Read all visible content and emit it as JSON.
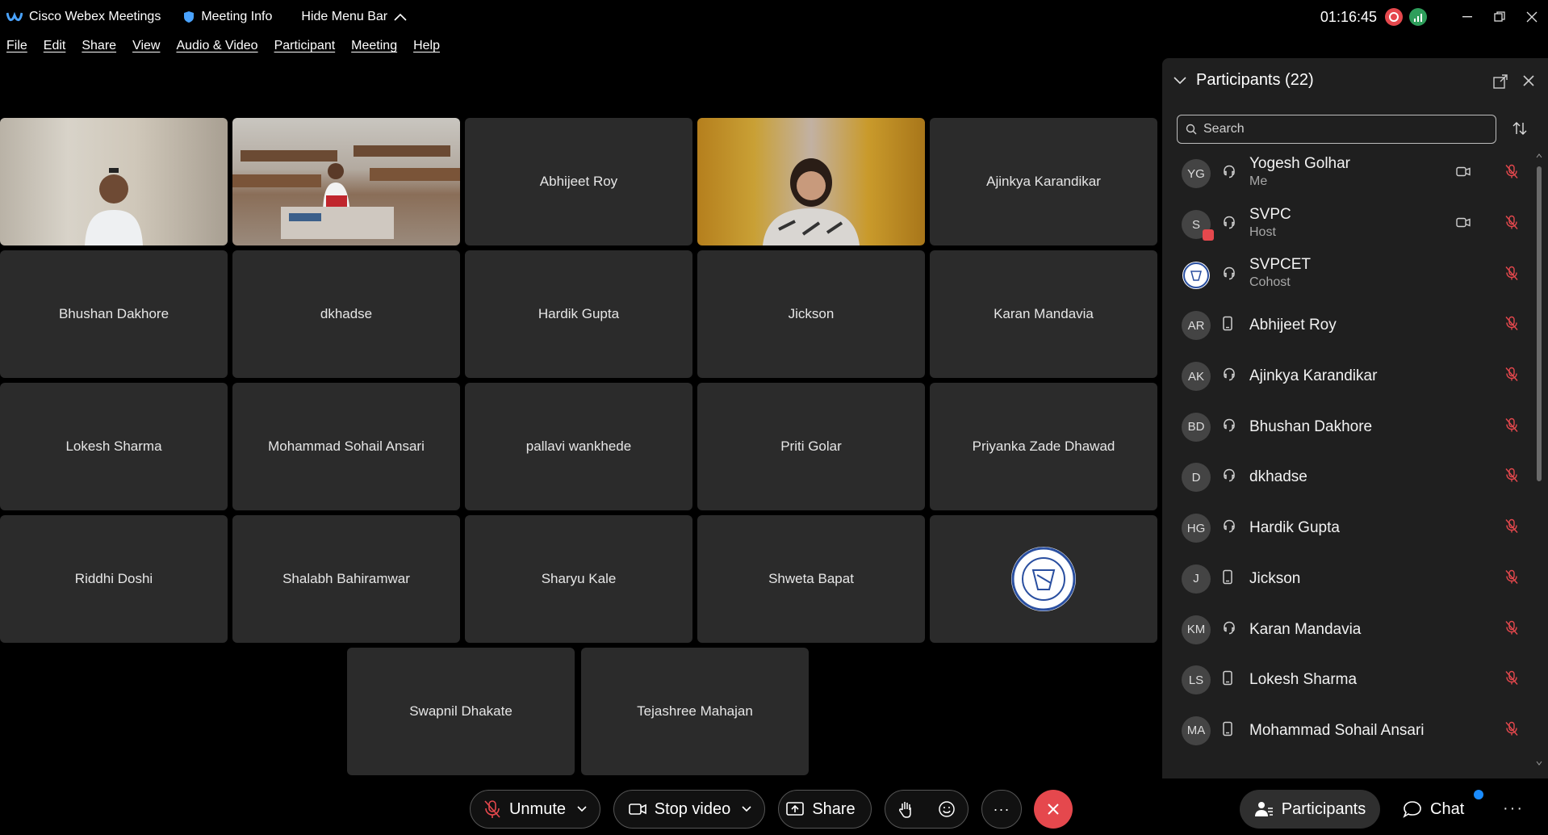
{
  "titlebar": {
    "app_name": "Cisco Webex Meetings",
    "meeting_info": "Meeting Info",
    "hide_menu_bar": "Hide Menu Bar",
    "timer": "01:16:45"
  },
  "menu": [
    "File",
    "Edit",
    "Share",
    "View",
    "Audio & Video",
    "Participant",
    "Meeting",
    "Help"
  ],
  "tiles": [
    {
      "name": "",
      "kind": "video1"
    },
    {
      "name": "",
      "kind": "video2"
    },
    {
      "name": "Abhijeet Roy",
      "kind": "name"
    },
    {
      "name": "",
      "kind": "video3"
    },
    {
      "name": "Ajinkya Karandikar",
      "kind": "name"
    },
    {
      "name": "Bhushan Dakhore",
      "kind": "name"
    },
    {
      "name": "dkhadse",
      "kind": "name"
    },
    {
      "name": "Hardik Gupta",
      "kind": "name"
    },
    {
      "name": "Jickson",
      "kind": "name"
    },
    {
      "name": "Karan Mandavia",
      "kind": "name"
    },
    {
      "name": "Lokesh Sharma",
      "kind": "name"
    },
    {
      "name": "Mohammad Sohail Ansari",
      "kind": "name"
    },
    {
      "name": "pallavi wankhede",
      "kind": "name"
    },
    {
      "name": "Priti Golar",
      "kind": "name"
    },
    {
      "name": "Priyanka Zade Dhawad",
      "kind": "name"
    },
    {
      "name": "Riddhi Doshi",
      "kind": "name"
    },
    {
      "name": "Shalabh Bahiramwar",
      "kind": "name"
    },
    {
      "name": "Sharyu Kale",
      "kind": "name"
    },
    {
      "name": "Shweta Bapat",
      "kind": "name"
    },
    {
      "name": "",
      "kind": "logo"
    },
    {
      "name": "Swapnil Dhakate",
      "kind": "name"
    },
    {
      "name": "Tejashree Mahajan",
      "kind": "name"
    }
  ],
  "panel": {
    "title": "Participants (22)",
    "search_placeholder": "Search",
    "participants": [
      {
        "initials": "YG",
        "name": "Yogesh Golhar",
        "role": "Me",
        "device": "headset",
        "camera": true
      },
      {
        "initials": "S",
        "name": "SVPC",
        "role": "Host",
        "device": "headset",
        "camera": true,
        "host_badge": true
      },
      {
        "initials": "",
        "name": "SVPCET",
        "role": "Cohost",
        "device": "headset",
        "camera": false,
        "logo": true
      },
      {
        "initials": "AR",
        "name": "Abhijeet Roy",
        "role": "",
        "device": "phone",
        "camera": false
      },
      {
        "initials": "AK",
        "name": "Ajinkya Karandikar",
        "role": "",
        "device": "headset",
        "camera": false
      },
      {
        "initials": "BD",
        "name": "Bhushan Dakhore",
        "role": "",
        "device": "headset",
        "camera": false
      },
      {
        "initials": "D",
        "name": "dkhadse",
        "role": "",
        "device": "headset",
        "camera": false
      },
      {
        "initials": "HG",
        "name": "Hardik Gupta",
        "role": "",
        "device": "headset",
        "camera": false
      },
      {
        "initials": "J",
        "name": "Jickson",
        "role": "",
        "device": "phone",
        "camera": false
      },
      {
        "initials": "KM",
        "name": "Karan Mandavia",
        "role": "",
        "device": "headset",
        "camera": false
      },
      {
        "initials": "LS",
        "name": "Lokesh Sharma",
        "role": "",
        "device": "phone",
        "camera": false
      },
      {
        "initials": "MA",
        "name": "Mohammad Sohail Ansari",
        "role": "",
        "device": "phone",
        "camera": false
      }
    ]
  },
  "toolbar": {
    "unmute": "Unmute",
    "stop_video": "Stop video",
    "share": "Share",
    "participants": "Participants",
    "chat": "Chat"
  },
  "colors": {
    "end_call": "#e5484d",
    "mute_red": "#e5484d",
    "tile_bg": "#2b2b2b",
    "panel_bg": "#1f1f1f"
  }
}
